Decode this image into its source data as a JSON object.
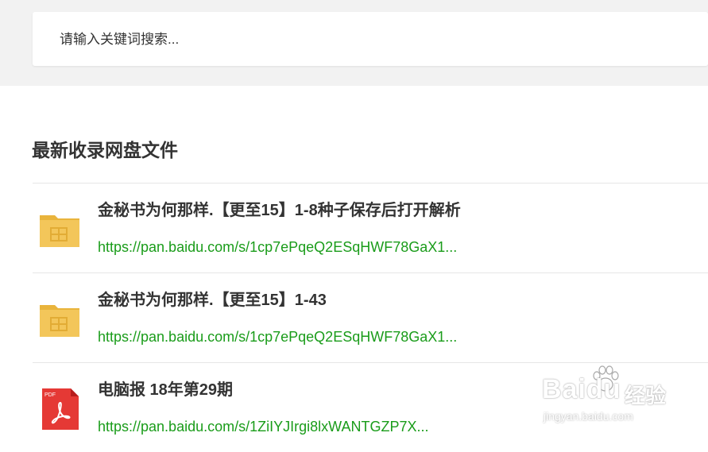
{
  "search": {
    "placeholder": "请输入关键词搜索..."
  },
  "section": {
    "title": "最新收录网盘文件"
  },
  "files": [
    {
      "title": "金秘书为何那样.【更至15】1-8种子保存后打开解析",
      "link": "https://pan.baidu.com/s/1cp7ePqeQ2ESqHWF78GaX1...",
      "icon": "folder-icon"
    },
    {
      "title": "金秘书为何那样.【更至15】1-43",
      "link": "https://pan.baidu.com/s/1cp7ePqeQ2ESqHWF78GaX1...",
      "icon": "folder-icon"
    },
    {
      "title": "电脑报 18年第29期",
      "link": "https://pan.baidu.com/s/1ZiIYJIrgi8lxWANTGZP7X...",
      "icon": "pdf-icon"
    }
  ],
  "watermark": {
    "brand": "Baidu",
    "brand_cn": "经验",
    "url": "jingyan.baidu.com"
  },
  "colors": {
    "link": "#1a9c1a",
    "folder": "#f0c14b",
    "pdf": "#e53935"
  }
}
